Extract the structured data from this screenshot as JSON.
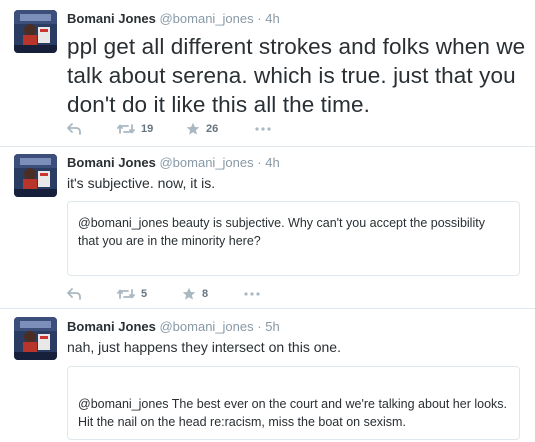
{
  "tweets": [
    {
      "name": "Bomani Jones",
      "handle": "@bomani_jones",
      "sep": "·",
      "time": "4h",
      "text": "ppl get all different strokes and folks when we talk about serena. which is true. just that you don't do it like this all the time.",
      "retweets": "19",
      "favorites": "26"
    },
    {
      "name": "Bomani Jones",
      "handle": "@bomani_jones",
      "sep": "·",
      "time": "4h",
      "text": "it's subjective. now, it is.",
      "quote": "@bomani_jones beauty is subjective. Why can't you accept the possibility that you are in the minority here?",
      "retweets": "5",
      "favorites": "8"
    },
    {
      "name": "Bomani Jones",
      "handle": "@bomani_jones",
      "sep": "·",
      "time": "5h",
      "text": "nah, just happens they intersect on this one.",
      "quote": "@bomani_jones The best ever on the court and we're talking about her looks. Hit the nail on the head re:racism, miss the boat on sexism."
    }
  ],
  "icons": {
    "reply": "reply-icon",
    "retweet": "retweet-icon",
    "favorite": "star-icon",
    "more": "more-icon"
  },
  "colors": {
    "text": "#292f33",
    "meta": "#8899a6",
    "border": "#e1e8ed"
  }
}
